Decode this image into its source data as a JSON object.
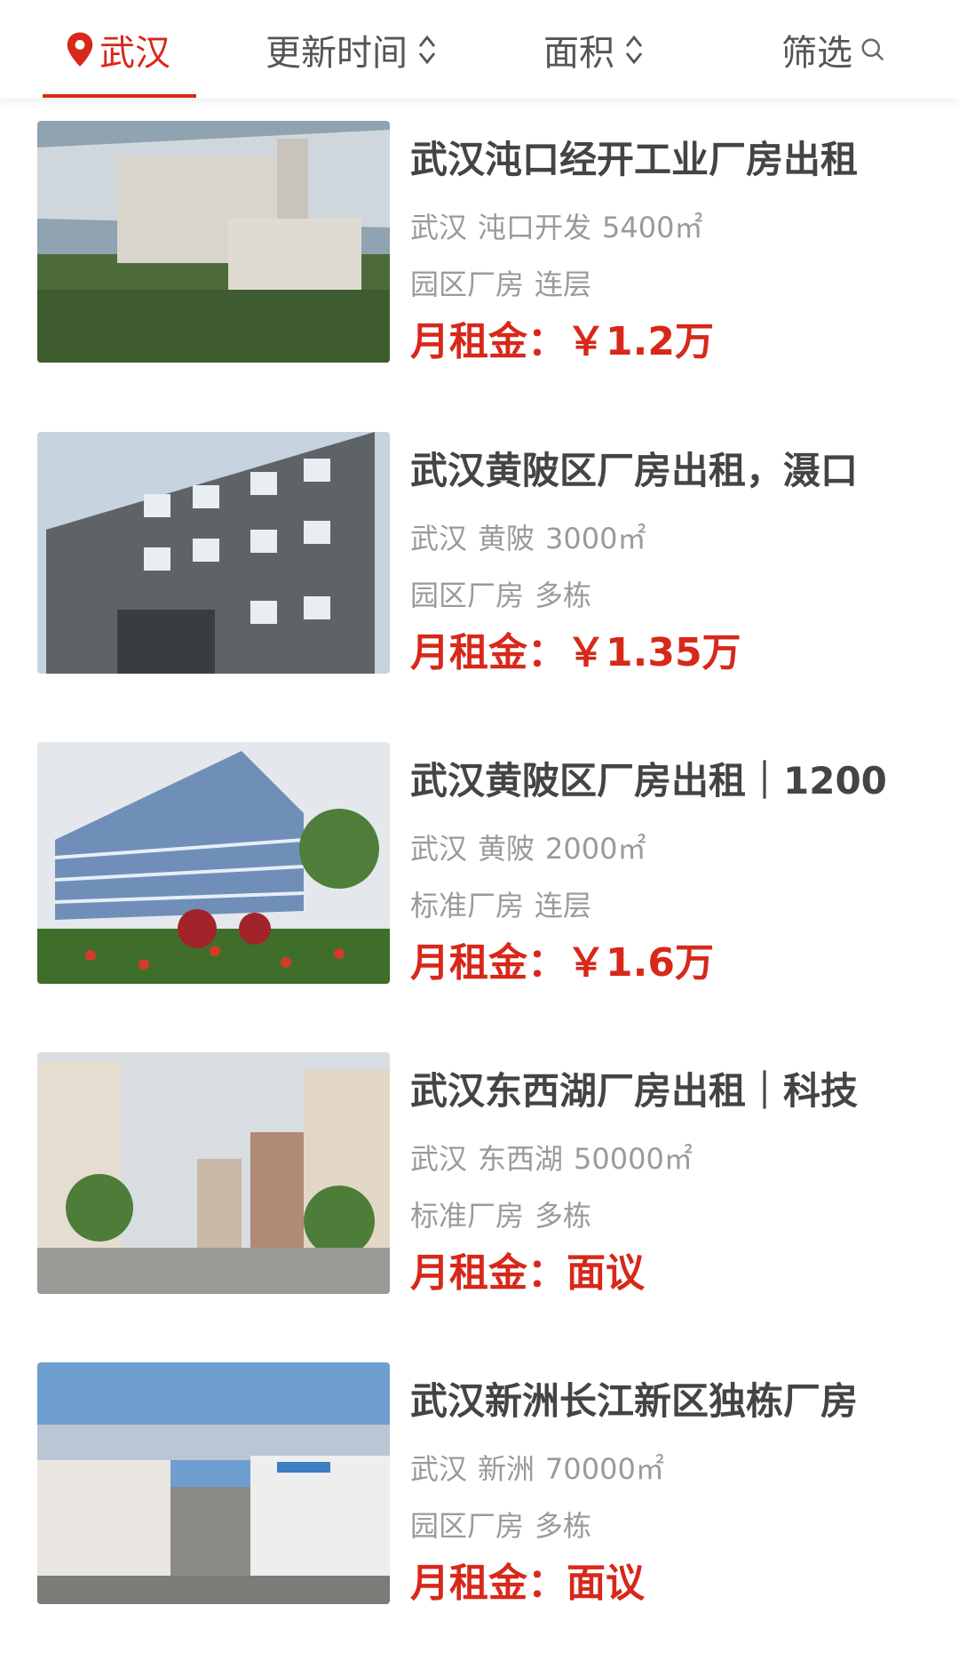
{
  "filter_bar": {
    "city_label": "武汉",
    "sort_time_label": "更新时间",
    "area_label": "面积",
    "filter_label": "筛选",
    "accent_color": "#d7281a",
    "icons": [
      "location-pin-icon",
      "sort-updown-icon",
      "search-icon"
    ]
  },
  "listings": [
    {
      "title": "武汉沌口经开工业厂房出租",
      "city": "武汉",
      "district": "沌口开发",
      "area": "5400㎡",
      "category": "园区厂房",
      "floor_type": "连层",
      "price_label": "月租金：",
      "price_value": "￥1.2万"
    },
    {
      "title": "武汉黄陂区厂房出租，滠口",
      "city": "武汉",
      "district": "黄陂",
      "area": "3000㎡",
      "category": "园区厂房",
      "floor_type": "多栋",
      "price_label": "月租金：",
      "price_value": "￥1.35万"
    },
    {
      "title": "武汉黄陂区厂房出租｜1200",
      "city": "武汉",
      "district": "黄陂",
      "area": "2000㎡",
      "category": "标准厂房",
      "floor_type": "连层",
      "price_label": "月租金：",
      "price_value": "￥1.6万"
    },
    {
      "title": "武汉东西湖厂房出租｜科技",
      "city": "武汉",
      "district": "东西湖",
      "area": "50000㎡",
      "category": "标准厂房",
      "floor_type": "多栋",
      "price_label": "月租金：",
      "price_value": "面议"
    },
    {
      "title": "武汉新洲长江新区独栋厂房",
      "city": "武汉",
      "district": "新洲",
      "area": "70000㎡",
      "category": "园区厂房",
      "floor_type": "多栋",
      "price_label": "月租金：",
      "price_value": "面议"
    }
  ]
}
